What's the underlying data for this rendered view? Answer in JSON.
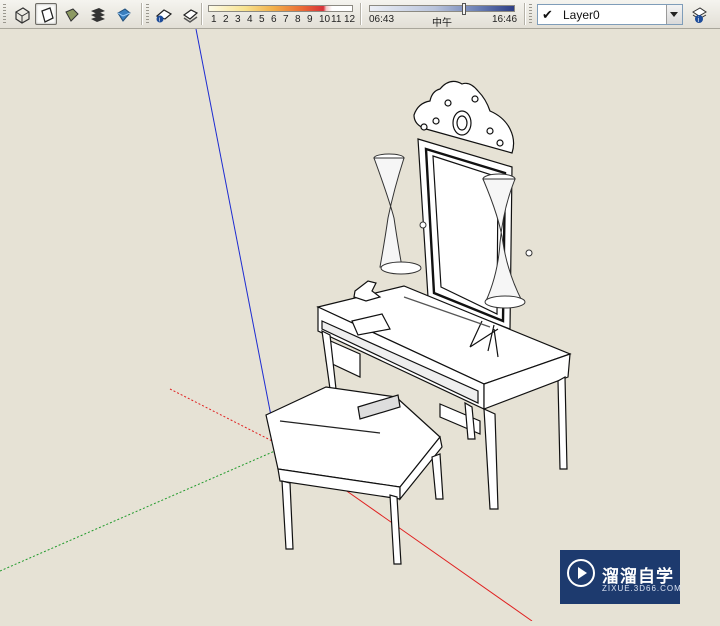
{
  "toolbar": {
    "styles": [
      {
        "name": "xray-style-icon",
        "active": false
      },
      {
        "name": "wireframe-style-icon",
        "active": true
      },
      {
        "name": "hidden-line-style-icon",
        "active": false
      },
      {
        "name": "shaded-style-icon",
        "active": false
      },
      {
        "name": "shaded-textures-style-icon",
        "active": false
      }
    ],
    "shadows": {
      "months": [
        "1",
        "2",
        "3",
        "4",
        "5",
        "6",
        "7",
        "8",
        "9",
        "10",
        "11",
        "12"
      ],
      "time_start": "06:43",
      "time_mid": "中午",
      "time_end": "16:46",
      "time_position": 0.64
    },
    "layer": {
      "current": "Layer0",
      "visible_check": "✔"
    }
  },
  "viewport": {
    "background_color": "#e6e2d5",
    "axes": {
      "blue": "#1d2bd1",
      "red": "#e02020",
      "green": "#1f9a2a"
    }
  },
  "watermark": {
    "title": "溜溜自学",
    "url": "ZIXUE.3D66.COM"
  }
}
